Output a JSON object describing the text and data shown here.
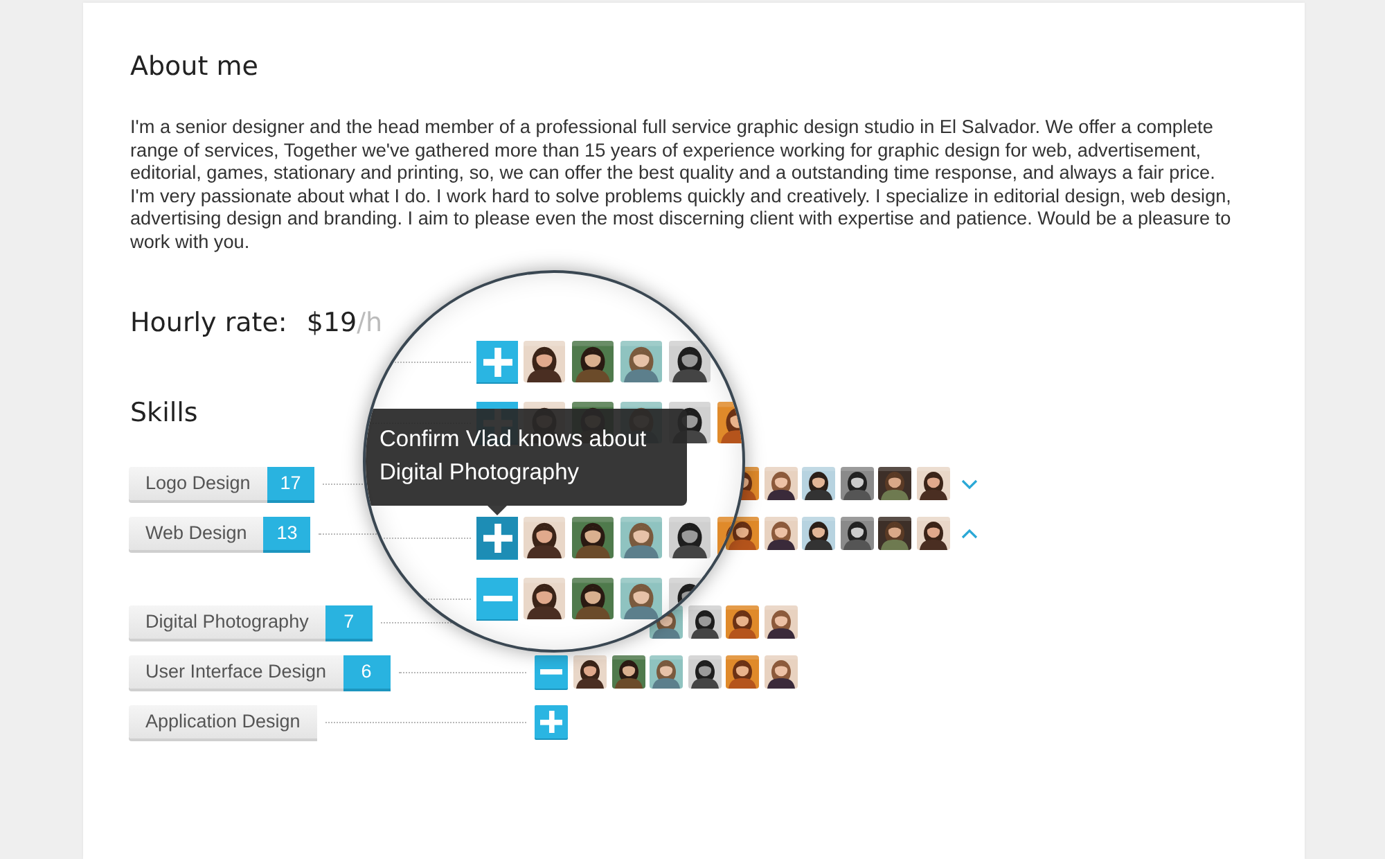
{
  "about": {
    "title": "About me",
    "text": "I'm a senior designer and the head member of a professional full service graphic design studio in El Salvador. We offer a complete range of services, Together we've gathered more than 15 years of experience working for graphic design for web, advertisement, editorial, games, stationary and printing, so, we can offer the best quality and a outstanding time response, and always a fair price. I'm very passionate about what I do. I work hard to solve problems quickly and creatively. I specialize in editorial design, web design, advertising design and branding. I aim to please even the most discerning client with expertise and patience. Would be a pleasure to work with you."
  },
  "hourly_rate": {
    "label": "Hourly rate:",
    "amount": "$19",
    "unit": "/h"
  },
  "skills": {
    "title": "Skills",
    "items": [
      {
        "name": "Logo Design",
        "count": "17",
        "expanded": false
      },
      {
        "name": "Web Design",
        "count": "13",
        "expanded": true
      },
      {
        "name": "Digital Photography",
        "count": "7"
      },
      {
        "name": "User Interface Design",
        "count": "6",
        "endorse": {
          "kind": "minus"
        }
      },
      {
        "name": "Application Design",
        "endorse": {
          "kind": "plus"
        }
      }
    ]
  },
  "lens": {
    "tooltip": "Confirm Vlad knows about Digital Photography",
    "rows": [
      {
        "endorse": {
          "kind": "plus"
        },
        "hovered": false
      },
      {
        "endorse": {
          "kind": "plus"
        },
        "hovered": false
      },
      {
        "endorse": {
          "kind": "plus"
        },
        "hovered": true
      },
      {
        "endorse": {
          "kind": "minus"
        },
        "hovered": false
      }
    ]
  }
}
